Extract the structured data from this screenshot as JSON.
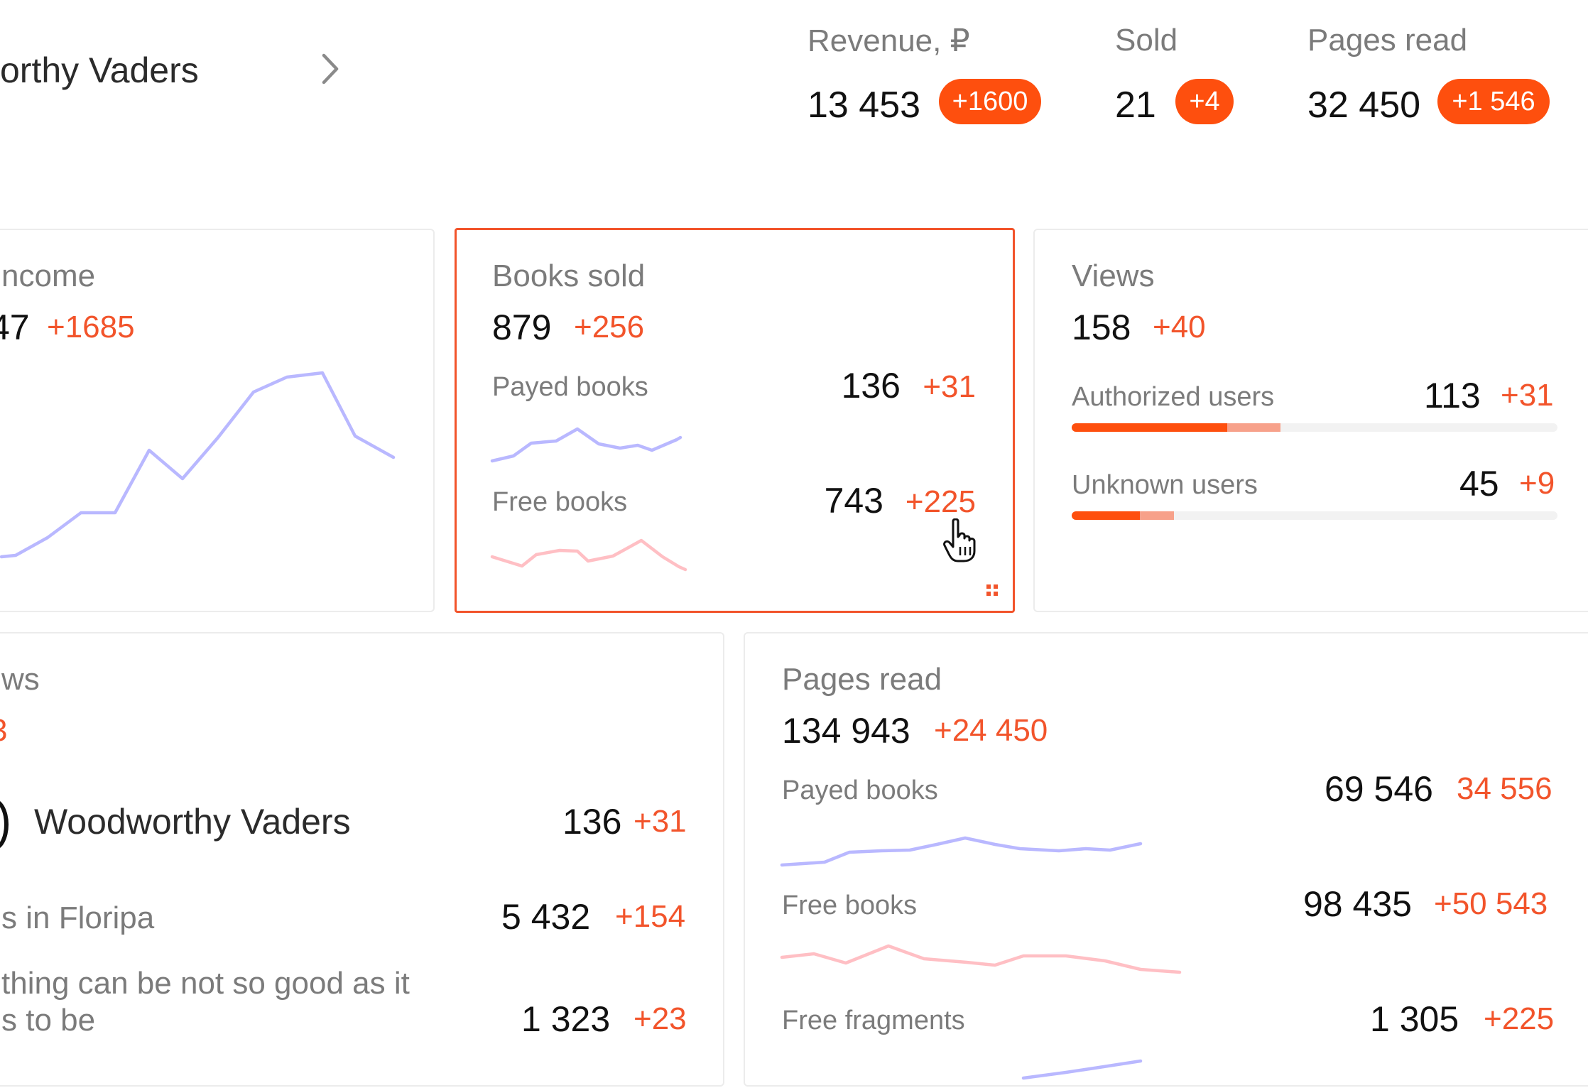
{
  "header": {
    "author_name": "orthy Vaders",
    "stats": [
      {
        "label": "Revenue, ₽",
        "value": "13 453",
        "delta": "+1600"
      },
      {
        "label": "Sold",
        "value": "21",
        "delta": "+4"
      },
      {
        "label": "Pages read",
        "value": "32 450",
        "delta": "+1 546"
      }
    ]
  },
  "colors": {
    "accent": "#fe4f0e",
    "delta_text": "#f2542b",
    "spark_paid": "#b9b8ff",
    "spark_free": "#ffbfc4"
  },
  "income": {
    "title": "ncome",
    "value": "47",
    "delta": "+1685"
  },
  "books_sold": {
    "title": "Books sold",
    "value": "879",
    "delta": "+256",
    "rows": [
      {
        "label": "Payed books",
        "value": "136",
        "delta": "+31"
      },
      {
        "label": "Free books",
        "value": "743",
        "delta": "+225"
      }
    ]
  },
  "views": {
    "title": "Views",
    "value": "158",
    "delta": "+40",
    "rows": [
      {
        "label": "Authorized users",
        "value": "113",
        "delta": "+31",
        "level": 0.32,
        "delta_level": 0.11
      },
      {
        "label": "Unknown users",
        "value": "45",
        "delta": "+9",
        "level": 0.14,
        "delta_level": 0.07
      }
    ]
  },
  "reviews": {
    "title": "ws",
    "delta": "3",
    "rows": [
      {
        "label": "Woodworthy Vaders",
        "value": "136",
        "delta": "+31"
      },
      {
        "label": "s in Floripa",
        "value": "5 432",
        "delta": "+154"
      },
      {
        "label_line1": "thing can be not so good as it",
        "label_line2": "s to be",
        "value": "1 323",
        "delta": "+23"
      }
    ]
  },
  "pages_read": {
    "title": "Pages read",
    "value": "134 943",
    "delta": "+24 450",
    "rows": [
      {
        "label": "Payed books",
        "value": "69 546",
        "delta": "34 556"
      },
      {
        "label": "Free books",
        "value": "98 435",
        "delta": "+50 543"
      },
      {
        "label": "Free fragments",
        "value": "1 305",
        "delta": "+225"
      }
    ]
  }
}
